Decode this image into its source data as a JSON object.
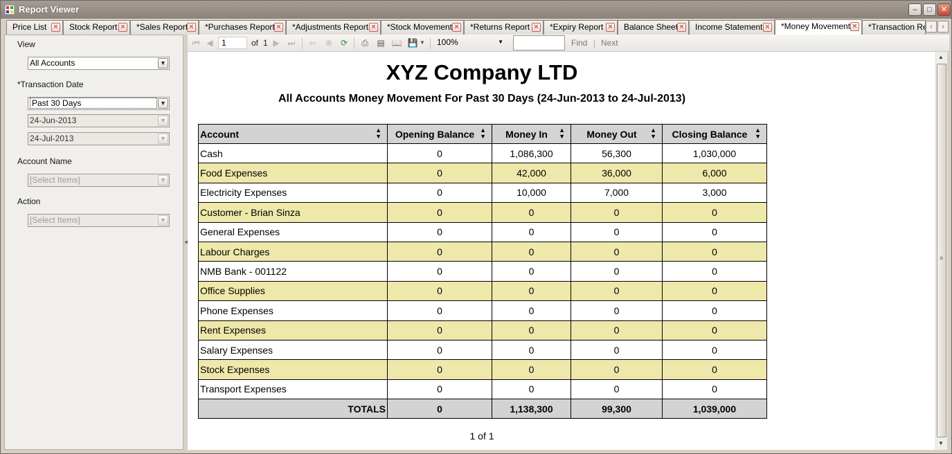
{
  "window": {
    "title": "Report Viewer"
  },
  "tabs": [
    {
      "label": "Price List"
    },
    {
      "label": "Stock Report"
    },
    {
      "label": "*Sales Report"
    },
    {
      "label": "*Purchases Report"
    },
    {
      "label": "*Adjustments Report"
    },
    {
      "label": "*Stock Movement"
    },
    {
      "label": "*Returns Report"
    },
    {
      "label": "*Expiry Report"
    },
    {
      "label": "Balance Sheet"
    },
    {
      "label": "Income Statement"
    },
    {
      "label": "*Money Movement"
    },
    {
      "label": "*Transaction Re"
    }
  ],
  "params": {
    "view_label": "View",
    "view_value": "All Accounts",
    "date_label": "*Transaction Date",
    "date_range_value": "Past 30 Days",
    "date_from": "24-Jun-2013",
    "date_to": "24-Jul-2013",
    "account_label": "Account Name",
    "account_placeholder": "[Select Items]",
    "action_label": "Action",
    "action_placeholder": "[Select Items]"
  },
  "toolbar": {
    "page": "1",
    "of_label": "of",
    "total_pages": "1",
    "zoom": "100%",
    "find_label": "Find",
    "separator": "|",
    "next_label": "Next"
  },
  "report": {
    "company": "XYZ Company LTD",
    "subtitle": "All Accounts Money Movement For Past 30 Days (24-Jun-2013 to 24-Jul-2013)",
    "columns": [
      "Account",
      "Opening Balance",
      "Money In",
      "Money Out",
      "Closing Balance"
    ],
    "rows": [
      [
        "Cash",
        "0",
        "1,086,300",
        "56,300",
        "1,030,000"
      ],
      [
        "Food Expenses",
        "0",
        "42,000",
        "36,000",
        "6,000"
      ],
      [
        "Electricity Expenses",
        "0",
        "10,000",
        "7,000",
        "3,000"
      ],
      [
        "Customer - Brian Sinza",
        "0",
        "0",
        "0",
        "0"
      ],
      [
        "General Expenses",
        "0",
        "0",
        "0",
        "0"
      ],
      [
        "Labour Charges",
        "0",
        "0",
        "0",
        "0"
      ],
      [
        "NMB Bank - 001122",
        "0",
        "0",
        "0",
        "0"
      ],
      [
        "Office Supplies",
        "0",
        "0",
        "0",
        "0"
      ],
      [
        "Phone Expenses",
        "0",
        "0",
        "0",
        "0"
      ],
      [
        "Rent Expenses",
        "0",
        "0",
        "0",
        "0"
      ],
      [
        "Salary Expenses",
        "0",
        "0",
        "0",
        "0"
      ],
      [
        "Stock Expenses",
        "0",
        "0",
        "0",
        "0"
      ],
      [
        "Transport Expenses",
        "0",
        "0",
        "0",
        "0"
      ]
    ],
    "totals": [
      "TOTALS",
      "0",
      "1,138,300",
      "99,300",
      "1,039,000"
    ],
    "page_footer": "1 of 1"
  },
  "colors": {
    "alt_row": "#eee8aa",
    "header_bg": "#d3d3d3",
    "totals_bg": "#d3d3d3"
  }
}
